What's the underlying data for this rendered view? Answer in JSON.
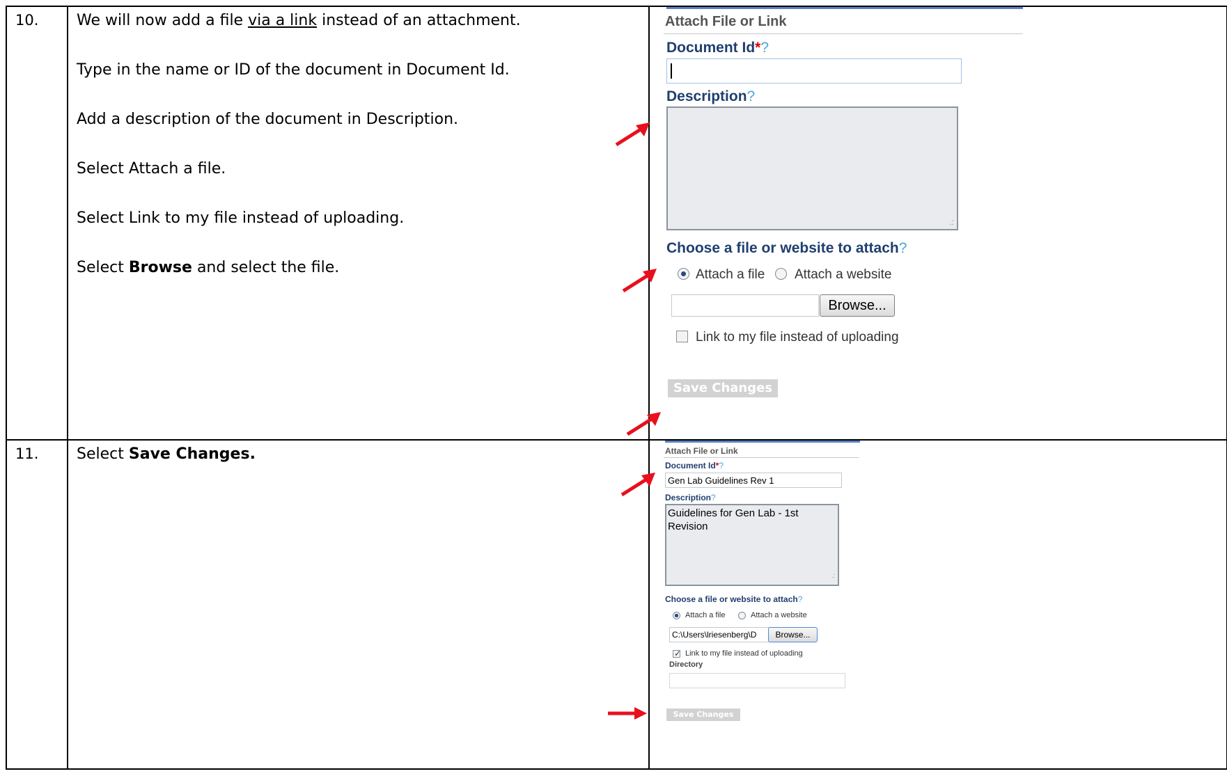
{
  "steps": [
    {
      "number": "10.",
      "lines": {
        "l1_pre": "We will now add a file ",
        "l1_link": "via a link",
        "l1_post": " instead of an attachment.",
        "l2": "Type in the name or ID of the document in Document Id.",
        "l3": "Add a description of the document in Description.",
        "l4": "Select Attach a file.",
        "l5": "Select Link to my file instead of uploading.",
        "l6_pre": "Select ",
        "l6_bold": "Browse",
        "l6_post": " and select the file."
      },
      "form": {
        "header": "Attach File or Link",
        "doc_label": "Document Id",
        "required_mark": "*",
        "help_mark": "?",
        "doc_value": "",
        "desc_label": "Description",
        "desc_value": "",
        "choose_label": "Choose a file or website to attach",
        "radio_file": "Attach a file",
        "radio_website": "Attach a website",
        "file_value": "",
        "browse_label": "Browse...",
        "link_checkbox": "Link to my file instead of uploading",
        "link_checked": false,
        "save_label": "Save Changes"
      }
    },
    {
      "number": "11.",
      "lines": {
        "l1_pre": "Select ",
        "l1_bold": "Save Changes."
      },
      "form": {
        "header": "Attach File or Link",
        "doc_label": "Document Id",
        "required_mark": "*",
        "help_mark": "?",
        "doc_value": "Gen Lab Guidelines Rev 1",
        "desc_label": "Description",
        "desc_value": "Guidelines for Gen Lab - 1st Revision",
        "choose_label": "Choose a file or website to attach",
        "radio_file": "Attach a file",
        "radio_website": "Attach a website",
        "file_value": "C:\\Users\\lriesenberg\\D",
        "browse_label": "Browse...",
        "link_checkbox": "Link to my file instead of uploading",
        "link_checked": true,
        "directory_label": "Directory",
        "save_label": "Save Changes"
      }
    }
  ],
  "colors": {
    "label_blue": "#1f3f6f",
    "arrow_red": "#e8101c",
    "help_blue": "#4aa6d8"
  }
}
